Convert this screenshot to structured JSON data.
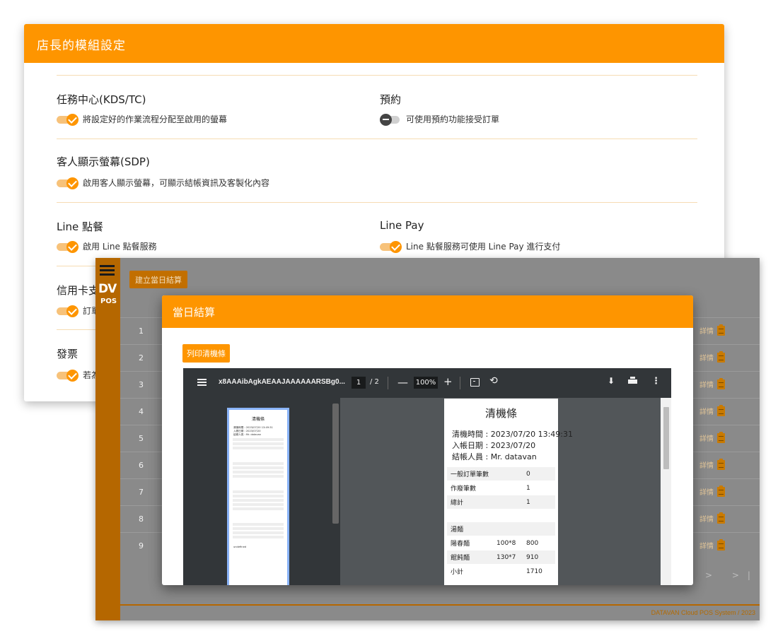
{
  "settings": {
    "title": "店長的模組設定",
    "modules": [
      {
        "title": "任務中心(KDS/TC)",
        "desc": "將設定好的作業流程分配至啟用的螢幕",
        "enabled": true
      },
      {
        "title": "預約",
        "desc": "可使用預約功能接受訂單",
        "enabled": false
      },
      {
        "title": "客人顯示螢幕(SDP)",
        "desc": "啟用客人顯示螢幕，可顯示結帳資訊及客製化內容",
        "enabled": true
      },
      {
        "title": "Line 點餐",
        "desc": "啟用 Line 點餐服務",
        "enabled": true
      },
      {
        "title": "Line Pay",
        "desc": "Line 點餐服務可使用 Line Pay 進行支付",
        "enabled": true
      },
      {
        "title": "信用卡支",
        "desc": "訂單",
        "enabled": true
      },
      {
        "title": "發票",
        "desc": "若為",
        "enabled": true
      }
    ]
  },
  "pos": {
    "logo_top": "DV",
    "logo_bottom": "POS",
    "build_button": "建立當日結算",
    "row_numbers": [
      "1",
      "2",
      "3",
      "4",
      "5",
      "6",
      "7",
      "8",
      "9"
    ],
    "detail_label": "詳情",
    "pager": "> >|",
    "footer": "DATAVAN Cloud POS System / 2023"
  },
  "dialog": {
    "title": "當日結算",
    "print_button": "列印清機條",
    "pdf": {
      "filename": "x8AAAibAgkAEAAJAAAAAARSBg0...",
      "page": "1",
      "page_total": "/ 2",
      "zoom": "100%",
      "minus": "—",
      "plus": "+",
      "rotate_glyph": "⟲",
      "download_glyph": "⬇",
      "more_glyph": "⋮"
    },
    "receipt": {
      "title": "清機條",
      "time_line": "清機時間 : 2023/07/20 13:49:31",
      "date_line": "入帳日期 : 2023/07/20",
      "user_line": "結帳人員 : Mr. datavan",
      "summary": [
        {
          "label": "一般訂單筆數",
          "value": "0"
        },
        {
          "label": "作廢筆數",
          "value": "1"
        },
        {
          "label": "總計",
          "value": "1"
        }
      ],
      "section_title": "湯麵",
      "items": [
        {
          "name": "陽春麵",
          "qty": "100*8",
          "amount": "800"
        },
        {
          "name": "餛飩麵",
          "qty": "130*7",
          "amount": "910"
        }
      ],
      "subtotal_label": "小計",
      "subtotal_value": "1710"
    },
    "thumbnail": {
      "lines": [
        "清機時間 : 2023/07/20 13:49:31",
        "入帳日期 : 2023/07/20",
        "結帳人員 : Mr. datavan"
      ],
      "footer_word": "undefined"
    }
  },
  "colors": {
    "accent": "#fe9500",
    "sidebar": "#b56700",
    "overlay": "#8a8a8a"
  }
}
